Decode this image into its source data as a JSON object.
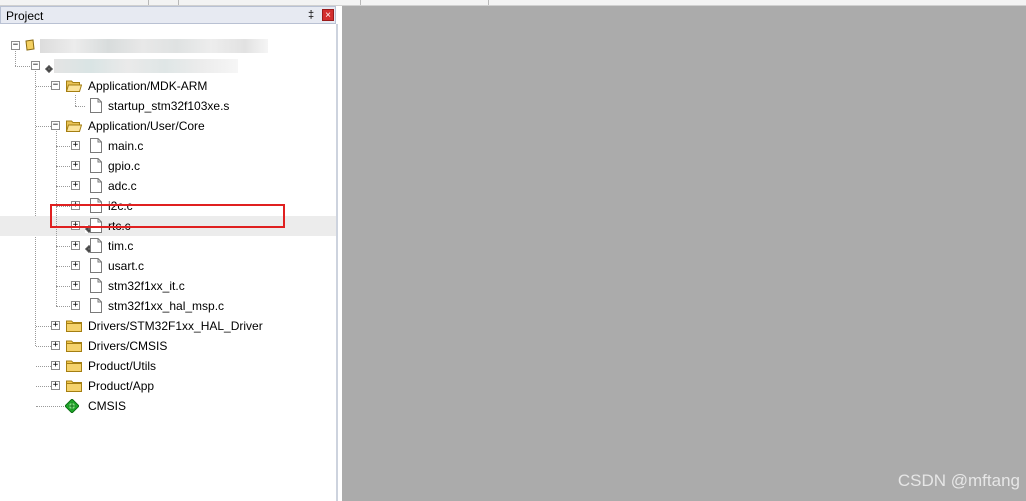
{
  "panel": {
    "title": "Project",
    "pin_glyph": "‡",
    "close_glyph": "×"
  },
  "tree": {
    "groups": [
      {
        "label": "Application/MDK-ARM",
        "expanded": true,
        "files": [
          {
            "name": "startup_stm32f103xe.s"
          }
        ]
      },
      {
        "label": "Application/User/Core",
        "expanded": true,
        "files": [
          {
            "name": "main.c"
          },
          {
            "name": "gpio.c"
          },
          {
            "name": "adc.c"
          },
          {
            "name": "i2c.c"
          },
          {
            "name": "rtc.c",
            "highlighted": true
          },
          {
            "name": "tim.c"
          },
          {
            "name": "usart.c"
          },
          {
            "name": "stm32f1xx_it.c"
          },
          {
            "name": "stm32f1xx_hal_msp.c"
          }
        ]
      },
      {
        "label": "Drivers/STM32F1xx_HAL_Driver",
        "expanded": false
      },
      {
        "label": "Drivers/CMSIS",
        "expanded": false
      },
      {
        "label": "Product/Utils",
        "expanded": false
      },
      {
        "label": "Product/App",
        "expanded": false
      }
    ],
    "cmsis_label": "CMSIS",
    "expand_glyph": "+",
    "collapse_glyph": "−"
  },
  "watermark": "CSDN @mftang",
  "colors": {
    "editor_bg": "#ababab",
    "highlight_box": "#e02020",
    "folder": "#f2c64b"
  }
}
